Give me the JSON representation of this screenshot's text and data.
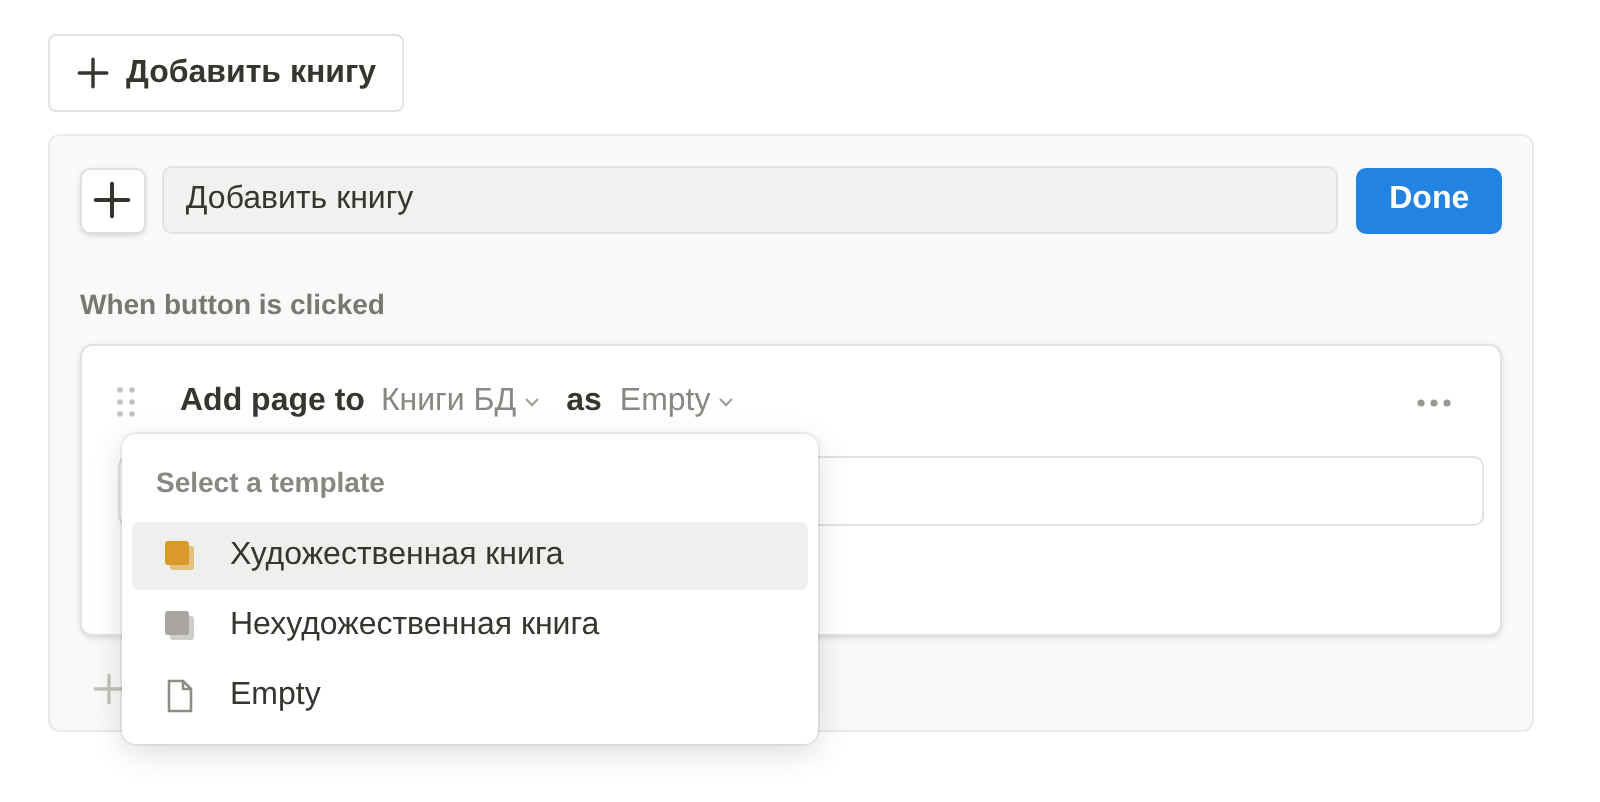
{
  "top_button": {
    "label": "Добавить книгу"
  },
  "editor": {
    "name_field": {
      "value": "Добавить книгу"
    },
    "done_button": "Done",
    "trigger_label": "When button is clicked",
    "action": {
      "verb": "Add page to",
      "database": "Книги БД",
      "connector": "as",
      "template": "Empty"
    }
  },
  "template_menu": {
    "header": "Select a template",
    "items": [
      {
        "label": "Художественная книга",
        "kind": "book",
        "color": "#d99a2b",
        "selected": true
      },
      {
        "label": "Нехудожественная книга",
        "kind": "book",
        "color": "#a9a5a0",
        "selected": false
      },
      {
        "label": "Empty",
        "kind": "page",
        "selected": false
      }
    ]
  }
}
